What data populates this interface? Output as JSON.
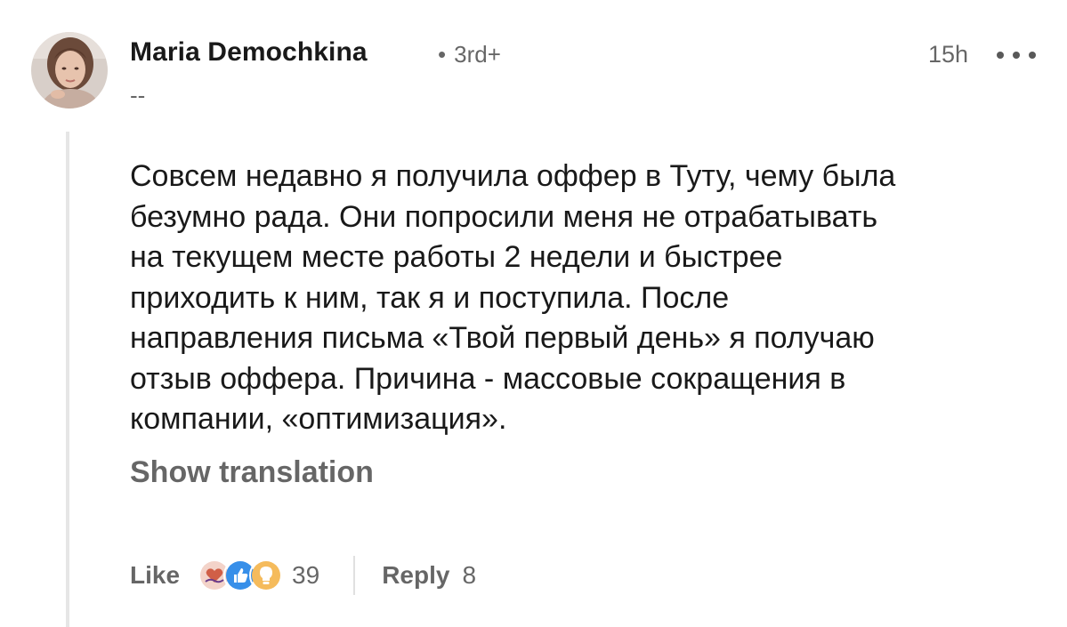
{
  "comment": {
    "author": {
      "name": "Maria Demochkina",
      "degree_separator": "•",
      "degree": "3rd+",
      "headline": "--"
    },
    "timestamp": "15h",
    "more_icon": "ellipsis-icon",
    "body": "Совсем недавно я получила оффер в Туту, чему была\nбезумно рада. Они попросили меня не отрабатывать\nна текущем месте работы 2 недели и быстрее\nприходить к ним, так я и поступила. После\nнаправления письма «Твой первый день» я получаю\nотзыв оффера. Причина - массовые сокращения в\nкомпании, «оптимизация».",
    "show_translation_label": "Show translation",
    "actions": {
      "like_label": "Like",
      "reactions": [
        {
          "icon": "love-reaction-icon",
          "color": "#b24020"
        },
        {
          "icon": "like-reaction-icon",
          "color": "#378fe9"
        },
        {
          "icon": "insightful-reaction-icon",
          "color": "#f5bb5c"
        }
      ],
      "reaction_count": "39",
      "reply_label": "Reply",
      "reply_count": "8"
    }
  }
}
